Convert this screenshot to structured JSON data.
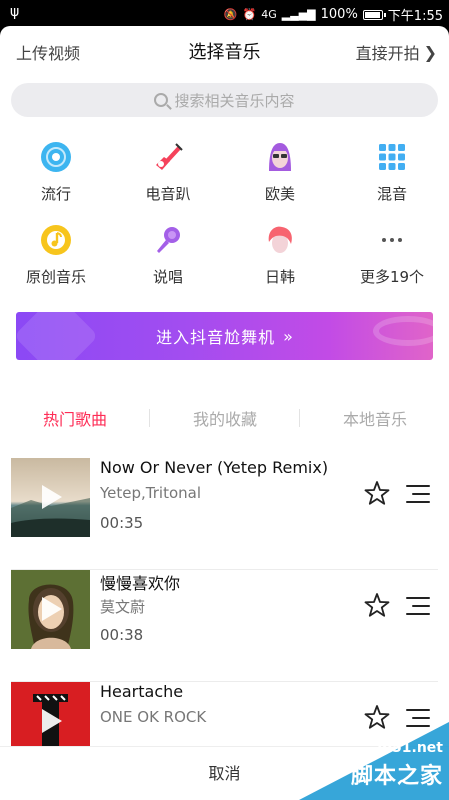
{
  "status_bar": {
    "usb_icon": "usb-icon",
    "network": "4G",
    "battery_percent_text": "100%",
    "battery_level": 1.0,
    "time": "下午1:55"
  },
  "header": {
    "left_label": "上传视频",
    "title": "选择音乐",
    "right_label": "直接开拍",
    "right_icon": "chevron-right-icon"
  },
  "search": {
    "placeholder": "搜索相关音乐内容",
    "icon": "search-icon"
  },
  "categories": [
    {
      "label": "流行",
      "icon": "disc-icon",
      "color": "#3db5f0"
    },
    {
      "label": "电音趴",
      "icon": "guitar-icon",
      "color": "#f5425b"
    },
    {
      "label": "欧美",
      "icon": "girl-face-icon",
      "color": "#a45bdf"
    },
    {
      "label": "混音",
      "icon": "grid-icon",
      "color": "#42aef2"
    },
    {
      "label": "原创音乐",
      "icon": "music-note-icon",
      "color": "#f7c51d"
    },
    {
      "label": "说唱",
      "icon": "microphone-icon",
      "color": "#a460e8"
    },
    {
      "label": "日韩",
      "icon": "boy-face-icon",
      "color": "#f76470"
    },
    {
      "label": "更多19个",
      "icon": "more-dots-icon",
      "color": "#555555"
    }
  ],
  "banner": {
    "label": "进入抖音尬舞机",
    "arrow": "»"
  },
  "tabs": [
    {
      "label": "热门歌曲",
      "active": true
    },
    {
      "label": "我的收藏",
      "active": false
    },
    {
      "label": "本地音乐",
      "active": false
    }
  ],
  "songs": [
    {
      "title": "Now Or Never (Yetep Remix)",
      "artist": "Yetep,Tritonal",
      "duration": "00:35"
    },
    {
      "title": "慢慢喜欢你",
      "artist": "莫文蔚",
      "duration": "00:38"
    },
    {
      "title": "Heartache",
      "artist": "ONE OK ROCK",
      "duration": ""
    }
  ],
  "cancel_label": "取消",
  "watermark": {
    "url": "jb51.net",
    "name": "脚本之家"
  },
  "colors": {
    "accent": "#fe2c55",
    "banner_start": "#8b49f5",
    "banner_end": "#e064c9"
  }
}
